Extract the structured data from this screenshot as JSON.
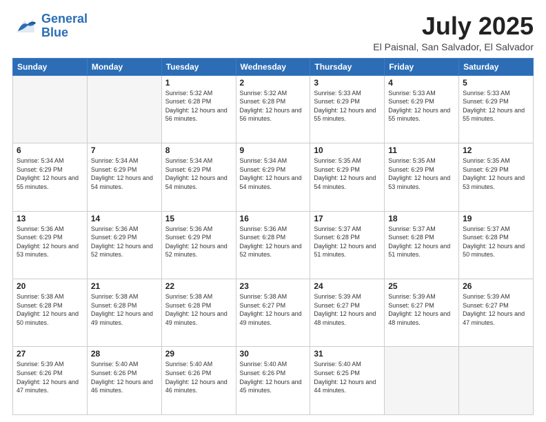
{
  "header": {
    "logo_line1": "General",
    "logo_line2": "Blue",
    "month": "July 2025",
    "location": "El Paisnal, San Salvador, El Salvador"
  },
  "weekdays": [
    "Sunday",
    "Monday",
    "Tuesday",
    "Wednesday",
    "Thursday",
    "Friday",
    "Saturday"
  ],
  "weeks": [
    [
      {
        "day": "",
        "info": ""
      },
      {
        "day": "",
        "info": ""
      },
      {
        "day": "1",
        "info": "Sunrise: 5:32 AM\nSunset: 6:28 PM\nDaylight: 12 hours and 56 minutes."
      },
      {
        "day": "2",
        "info": "Sunrise: 5:32 AM\nSunset: 6:28 PM\nDaylight: 12 hours and 56 minutes."
      },
      {
        "day": "3",
        "info": "Sunrise: 5:33 AM\nSunset: 6:29 PM\nDaylight: 12 hours and 55 minutes."
      },
      {
        "day": "4",
        "info": "Sunrise: 5:33 AM\nSunset: 6:29 PM\nDaylight: 12 hours and 55 minutes."
      },
      {
        "day": "5",
        "info": "Sunrise: 5:33 AM\nSunset: 6:29 PM\nDaylight: 12 hours and 55 minutes."
      }
    ],
    [
      {
        "day": "6",
        "info": "Sunrise: 5:34 AM\nSunset: 6:29 PM\nDaylight: 12 hours and 55 minutes."
      },
      {
        "day": "7",
        "info": "Sunrise: 5:34 AM\nSunset: 6:29 PM\nDaylight: 12 hours and 54 minutes."
      },
      {
        "day": "8",
        "info": "Sunrise: 5:34 AM\nSunset: 6:29 PM\nDaylight: 12 hours and 54 minutes."
      },
      {
        "day": "9",
        "info": "Sunrise: 5:34 AM\nSunset: 6:29 PM\nDaylight: 12 hours and 54 minutes."
      },
      {
        "day": "10",
        "info": "Sunrise: 5:35 AM\nSunset: 6:29 PM\nDaylight: 12 hours and 54 minutes."
      },
      {
        "day": "11",
        "info": "Sunrise: 5:35 AM\nSunset: 6:29 PM\nDaylight: 12 hours and 53 minutes."
      },
      {
        "day": "12",
        "info": "Sunrise: 5:35 AM\nSunset: 6:29 PM\nDaylight: 12 hours and 53 minutes."
      }
    ],
    [
      {
        "day": "13",
        "info": "Sunrise: 5:36 AM\nSunset: 6:29 PM\nDaylight: 12 hours and 53 minutes."
      },
      {
        "day": "14",
        "info": "Sunrise: 5:36 AM\nSunset: 6:29 PM\nDaylight: 12 hours and 52 minutes."
      },
      {
        "day": "15",
        "info": "Sunrise: 5:36 AM\nSunset: 6:29 PM\nDaylight: 12 hours and 52 minutes."
      },
      {
        "day": "16",
        "info": "Sunrise: 5:36 AM\nSunset: 6:28 PM\nDaylight: 12 hours and 52 minutes."
      },
      {
        "day": "17",
        "info": "Sunrise: 5:37 AM\nSunset: 6:28 PM\nDaylight: 12 hours and 51 minutes."
      },
      {
        "day": "18",
        "info": "Sunrise: 5:37 AM\nSunset: 6:28 PM\nDaylight: 12 hours and 51 minutes."
      },
      {
        "day": "19",
        "info": "Sunrise: 5:37 AM\nSunset: 6:28 PM\nDaylight: 12 hours and 50 minutes."
      }
    ],
    [
      {
        "day": "20",
        "info": "Sunrise: 5:38 AM\nSunset: 6:28 PM\nDaylight: 12 hours and 50 minutes."
      },
      {
        "day": "21",
        "info": "Sunrise: 5:38 AM\nSunset: 6:28 PM\nDaylight: 12 hours and 49 minutes."
      },
      {
        "day": "22",
        "info": "Sunrise: 5:38 AM\nSunset: 6:28 PM\nDaylight: 12 hours and 49 minutes."
      },
      {
        "day": "23",
        "info": "Sunrise: 5:38 AM\nSunset: 6:27 PM\nDaylight: 12 hours and 49 minutes."
      },
      {
        "day": "24",
        "info": "Sunrise: 5:39 AM\nSunset: 6:27 PM\nDaylight: 12 hours and 48 minutes."
      },
      {
        "day": "25",
        "info": "Sunrise: 5:39 AM\nSunset: 6:27 PM\nDaylight: 12 hours and 48 minutes."
      },
      {
        "day": "26",
        "info": "Sunrise: 5:39 AM\nSunset: 6:27 PM\nDaylight: 12 hours and 47 minutes."
      }
    ],
    [
      {
        "day": "27",
        "info": "Sunrise: 5:39 AM\nSunset: 6:26 PM\nDaylight: 12 hours and 47 minutes."
      },
      {
        "day": "28",
        "info": "Sunrise: 5:40 AM\nSunset: 6:26 PM\nDaylight: 12 hours and 46 minutes."
      },
      {
        "day": "29",
        "info": "Sunrise: 5:40 AM\nSunset: 6:26 PM\nDaylight: 12 hours and 46 minutes."
      },
      {
        "day": "30",
        "info": "Sunrise: 5:40 AM\nSunset: 6:26 PM\nDaylight: 12 hours and 45 minutes."
      },
      {
        "day": "31",
        "info": "Sunrise: 5:40 AM\nSunset: 6:25 PM\nDaylight: 12 hours and 44 minutes."
      },
      {
        "day": "",
        "info": ""
      },
      {
        "day": "",
        "info": ""
      }
    ]
  ]
}
